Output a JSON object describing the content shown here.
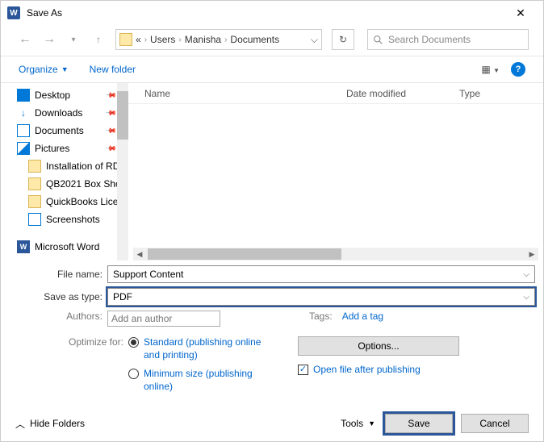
{
  "title": "Save As",
  "breadcrumb": {
    "prefix": "«",
    "items": [
      "Users",
      "Manisha",
      "Documents"
    ]
  },
  "search": {
    "placeholder": "Search Documents"
  },
  "toolbar": {
    "organize": "Organize",
    "new_folder": "New folder"
  },
  "columns": {
    "name": "Name",
    "modified": "Date modified",
    "type": "Type"
  },
  "sidebar": [
    {
      "label": "Desktop",
      "icon": "desktop",
      "pinned": true
    },
    {
      "label": "Downloads",
      "icon": "down",
      "pinned": true
    },
    {
      "label": "Documents",
      "icon": "doc",
      "pinned": true
    },
    {
      "label": "Pictures",
      "icon": "pic",
      "pinned": true
    },
    {
      "label": "Installation of RD",
      "icon": "folder",
      "indent": true
    },
    {
      "label": "QB2021 Box Sho",
      "icon": "folder",
      "indent": true
    },
    {
      "label": "QuickBooks Lice",
      "icon": "folder",
      "indent": true
    },
    {
      "label": "Screenshots",
      "icon": "ss",
      "indent": true
    },
    {
      "label": "Microsoft Word",
      "icon": "word",
      "spaced": true
    }
  ],
  "form": {
    "filename_label": "File name:",
    "filename_value": "Support Content",
    "type_label": "Save as type:",
    "type_value": "PDF",
    "authors_label": "Authors:",
    "authors_placeholder": "Add an author",
    "tags_label": "Tags:",
    "tags_link": "Add a tag",
    "optimize_label": "Optimize for:",
    "radio1": "Standard (publishing online and printing)",
    "radio2": "Minimum size (publishing online)",
    "options_btn": "Options...",
    "open_after": "Open file after publishing"
  },
  "bottom": {
    "hide": "Hide Folders",
    "tools": "Tools",
    "save": "Save",
    "cancel": "Cancel"
  }
}
